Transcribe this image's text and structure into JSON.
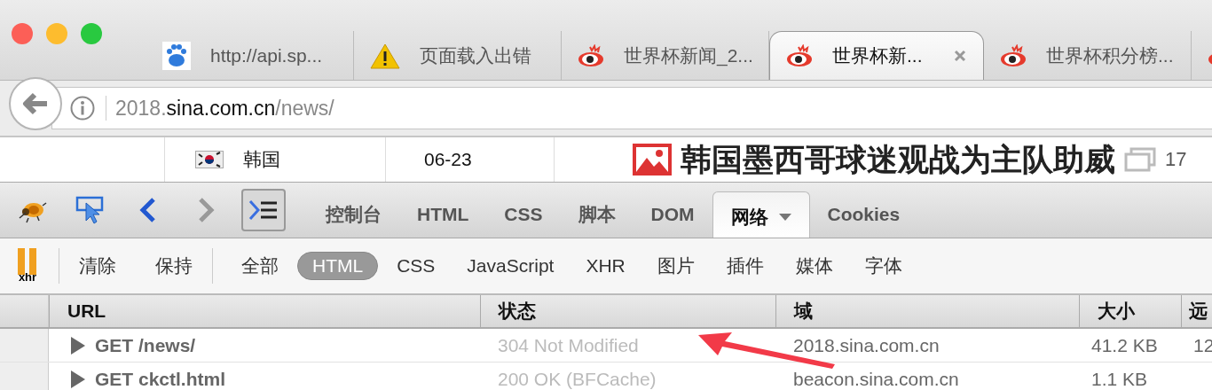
{
  "tabs": [
    {
      "kind": "paw",
      "label": "http://api.sp...",
      "selected": false
    },
    {
      "kind": "warning",
      "label": "页面载入出错",
      "selected": false
    },
    {
      "kind": "eye",
      "label": "世界杯新闻_2...",
      "selected": false
    },
    {
      "kind": "eye",
      "label": "世界杯新...",
      "selected": true
    },
    {
      "kind": "eye",
      "label": "世界杯积分榜...",
      "selected": false
    },
    {
      "kind": "eye",
      "selected": false
    }
  ],
  "address": {
    "prefix": "2018.",
    "domain": "sina.com.cn",
    "path": "/news/"
  },
  "page": {
    "team": "韩国",
    "date": "06-23",
    "headline": "韩国墨西哥球迷观战为主队助威",
    "count": "17"
  },
  "tools": [
    {
      "kind": "bug"
    },
    {
      "kind": "inspect"
    },
    {
      "kind": "back",
      "disabled": false
    },
    {
      "kind": "forward",
      "disabled": true
    },
    {
      "kind": "command",
      "selected": true
    }
  ],
  "panels": [
    {
      "label": "控制台",
      "selected": false
    },
    {
      "label": "HTML",
      "selected": false
    },
    {
      "label": "CSS",
      "selected": false
    },
    {
      "label": "脚本",
      "selected": false
    },
    {
      "label": "DOM",
      "selected": false
    },
    {
      "label": "网络",
      "selected": true
    },
    {
      "label": "Cookies",
      "selected": false
    }
  ],
  "xhr_label": "xhr",
  "actions": [
    "清除",
    "保持"
  ],
  "filters": [
    {
      "label": "全部",
      "selected": false
    },
    {
      "label": "HTML",
      "selected": true
    },
    {
      "label": "CSS",
      "selected": false
    },
    {
      "label": "JavaScript",
      "selected": false
    },
    {
      "label": "XHR",
      "selected": false
    },
    {
      "label": "图片",
      "selected": false
    },
    {
      "label": "插件",
      "selected": false
    },
    {
      "label": "媒体",
      "selected": false
    },
    {
      "label": "字体",
      "selected": false
    }
  ],
  "table": {
    "columns": [
      "URL",
      "状态",
      "域",
      "大小",
      "远"
    ],
    "rows": [
      {
        "url": "GET /news/",
        "status": "304 Not Modified",
        "domain": "2018.sina.com.cn",
        "size": "41.2 KB",
        "column_5": "12"
      },
      {
        "url": "GET ckctl.html",
        "status": "200 OK (BFCache)",
        "domain": "beacon.sina.com.cn",
        "size": "1.1 KB"
      }
    ]
  }
}
